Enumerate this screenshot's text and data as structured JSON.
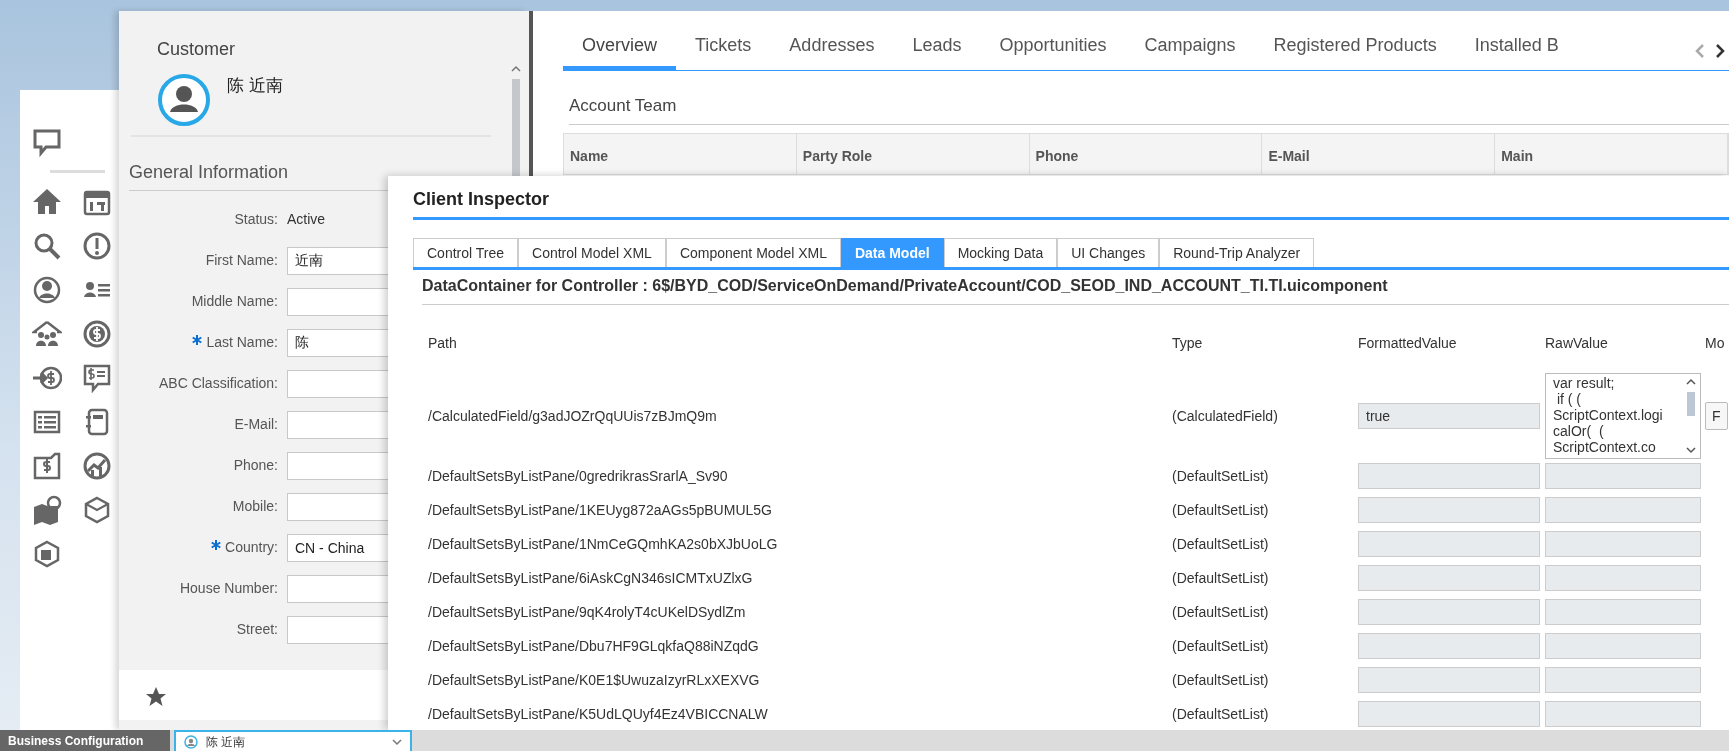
{
  "customer_panel": {
    "title": "Customer",
    "name": "陈 近南",
    "section_title": "General Information",
    "fields": [
      {
        "kind": "text",
        "label": "Status:",
        "value": "Active"
      },
      {
        "kind": "input",
        "label": "First Name:",
        "value": "近南",
        "required": false
      },
      {
        "kind": "input",
        "label": "Middle Name:",
        "required": false
      },
      {
        "kind": "input",
        "label": "Last Name:",
        "value": "陈",
        "required": true
      },
      {
        "kind": "input",
        "label": "ABC Classification:",
        "required": false
      },
      {
        "kind": "input",
        "label": "E-Mail:",
        "required": false
      },
      {
        "kind": "input",
        "label": "Phone:",
        "required": false
      },
      {
        "kind": "input",
        "label": "Mobile:",
        "required": false
      },
      {
        "kind": "input",
        "label": "Country:",
        "value": "CN - China",
        "required": true
      },
      {
        "kind": "input",
        "label": "House Number:",
        "required": false
      },
      {
        "kind": "input",
        "label": "Street:",
        "required": false
      }
    ]
  },
  "main": {
    "tabs": [
      {
        "label": "Overview",
        "selected": true
      },
      {
        "label": "Tickets",
        "selected": false
      },
      {
        "label": "Addresses",
        "selected": false
      },
      {
        "label": "Leads",
        "selected": false
      },
      {
        "label": "Opportunities",
        "selected": false
      },
      {
        "label": "Campaigns",
        "selected": false
      },
      {
        "label": "Registered Products",
        "selected": false
      },
      {
        "label": "Installed B",
        "selected": false
      }
    ],
    "section_title": "Account Team",
    "table": {
      "columns": [
        "Name",
        "Party Role",
        "Phone",
        "E-Mail",
        "Main"
      ]
    }
  },
  "inspector": {
    "title": "Client Inspector",
    "tabs": [
      {
        "label": "Control Tree",
        "selected": false
      },
      {
        "label": "Control Model XML",
        "selected": false
      },
      {
        "label": "Component Model XML",
        "selected": false
      },
      {
        "label": "Data Model",
        "selected": true
      },
      {
        "label": "Mocking Data",
        "selected": false
      },
      {
        "label": "UI Changes",
        "selected": false
      },
      {
        "label": "Round-Trip Analyzer",
        "selected": false
      }
    ],
    "heading": "DataContainer for Controller : 6$/BYD_COD/ServiceOnDemand/PrivateAccount/COD_SEOD_IND_ACCOUNT_TI.TI.uicomponent",
    "table": {
      "columns": [
        "Path",
        "Type",
        "FormattedValue",
        "RawValue",
        "Mo"
      ],
      "rows": [
        {
          "kind": "multiline",
          "path": "/CalculatedField/g3adJOZrQqUUis7zBJmQ9m",
          "type": "(CalculatedField)",
          "formatted_value": "true",
          "raw_value": "var result;\n if ( (\nScriptContext.logi\ncalOr(  (\nScriptContext.co",
          "action": "F"
        },
        {
          "kind": "single",
          "path": "/DefaultSetsByListPane/0gredrikrasSrarlA_Sv90",
          "type": "(DefaultSetList)"
        },
        {
          "kind": "single",
          "path": "/DefaultSetsByListPane/1KEUyg872aAGs5pBUMUL5G",
          "type": "(DefaultSetList)"
        },
        {
          "kind": "single",
          "path": "/DefaultSetsByListPane/1NmCeGQmhKA2s0bXJbUoLG",
          "type": "(DefaultSetList)"
        },
        {
          "kind": "single",
          "path": "/DefaultSetsByListPane/6iAskCgN346sICMTxUZlxG",
          "type": "(DefaultSetList)"
        },
        {
          "kind": "single",
          "path": "/DefaultSetsByListPane/9qK4rolyT4cUKelDSydlZm",
          "type": "(DefaultSetList)"
        },
        {
          "kind": "single",
          "path": "/DefaultSetsByListPane/Dbu7HF9GLqkfaQ88iNZqdG",
          "type": "(DefaultSetList)"
        },
        {
          "kind": "single",
          "path": "/DefaultSetsByListPane/K0E1$UwuzaIzyrRLxXEXVG",
          "type": "(DefaultSetList)"
        },
        {
          "kind": "single",
          "path": "/DefaultSetsByListPane/K5UdLQUyf4Ez4VBICCNALW",
          "type": "(DefaultSetList)"
        }
      ]
    }
  },
  "taskbar": {
    "tabs": [
      {
        "label": "Business Configuration",
        "selected": false
      },
      {
        "label": "陈 近南",
        "selected": true
      }
    ]
  }
}
